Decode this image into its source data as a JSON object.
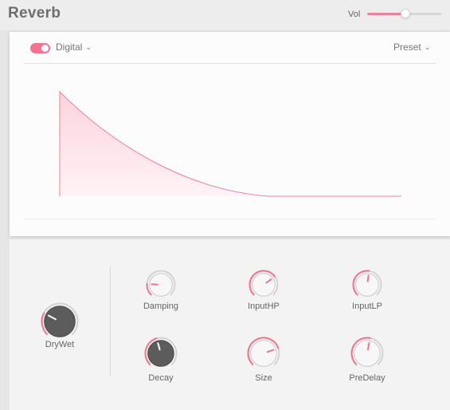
{
  "header": {
    "title": "Reverb",
    "vol_label": "Vol",
    "vol_value": 0.52
  },
  "display": {
    "enabled": true,
    "mode": "Digital",
    "preset": "Preset"
  },
  "knobs": [
    {
      "id": "drywet",
      "label": "DryWet",
      "value": 0.27,
      "style": "large"
    },
    {
      "id": "damping",
      "label": "Damping",
      "value": 0.18,
      "style": "small"
    },
    {
      "id": "inputhp",
      "label": "InputHP",
      "value": 0.7,
      "style": "small"
    },
    {
      "id": "inputlp",
      "label": "InputLP",
      "value": 0.53,
      "style": "small"
    },
    {
      "id": "decay",
      "label": "Decay",
      "value": 0.44,
      "style": "large"
    },
    {
      "id": "size",
      "label": "Size",
      "value": 0.76,
      "style": "small"
    },
    {
      "id": "predelay",
      "label": "PreDelay",
      "value": 0.54,
      "style": "small"
    }
  ],
  "colors": {
    "accent": "#f2728f",
    "envelope_fill": "#fde3ea",
    "knob_dark": "#5c5c5c",
    "knob_light": "#f7f7f7",
    "ring": "#d3d3d3"
  }
}
